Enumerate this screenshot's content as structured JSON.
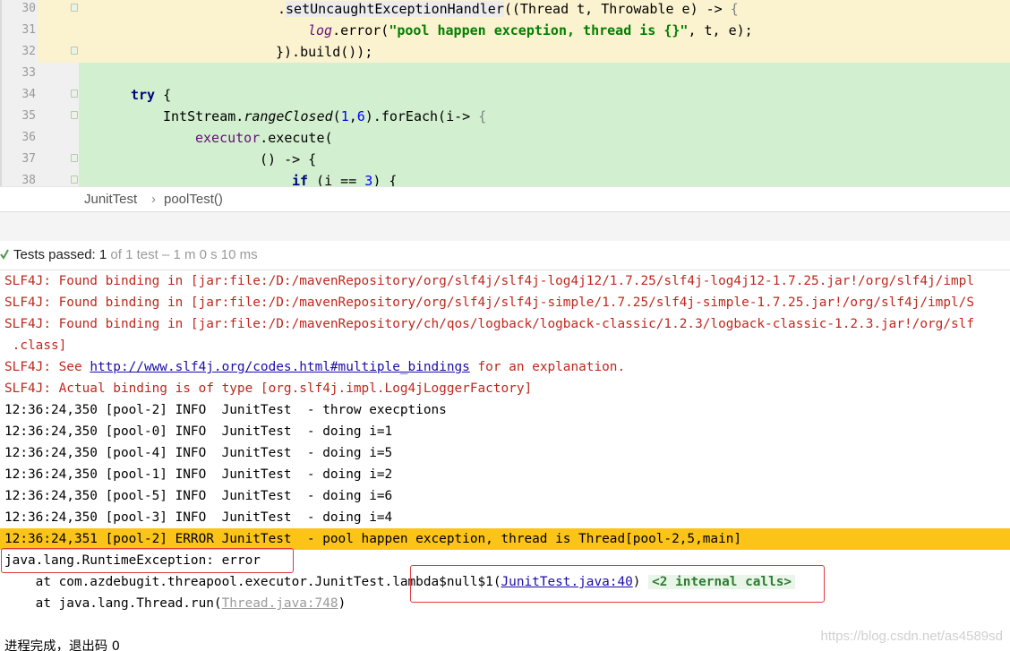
{
  "editor": {
    "lines": [
      {
        "num": "30",
        "code": ".setUncaughtExceptionHandler((Thread t, Throwable e) -> {"
      },
      {
        "num": "31",
        "code": "log.error(\"pool happen exception, thread is {}\", t, e);"
      },
      {
        "num": "32",
        "code": "}).build());"
      },
      {
        "num": "33",
        "code": ""
      },
      {
        "num": "34",
        "code": "try {"
      },
      {
        "num": "35",
        "code": "IntStream.rangeClosed(1,6).forEach(i-> {"
      },
      {
        "num": "36",
        "code": "executor.execute("
      },
      {
        "num": "37",
        "code": "() -> {"
      },
      {
        "num": "38",
        "code": "if (i == 3) {"
      }
    ],
    "tokens": {
      "l30_a": ".",
      "l30_b": "setUncaughtExceptionHandler",
      "l30_c": "((Thread t, Throwable e) -> ",
      "l30_d": "{",
      "l31_a": "log",
      "l31_b": ".error(",
      "l31_c": "\"pool happen exception, thread is {}\"",
      "l31_d": ", t, e);",
      "l32": "}).build());",
      "l34_a": "try",
      "l34_b": " {",
      "l35_a": "IntStream.",
      "l35_b": "rangeClosed",
      "l35_c": "(",
      "l35_d": "1",
      "l35_e": ",",
      "l35_f": "6",
      "l35_g": ").forEach(i-> ",
      "l35_h": "{",
      "l36_a": "executor",
      "l36_b": ".execute(",
      "l37": "() -> {",
      "l38_a": "if",
      "l38_b": " (i == ",
      "l38_c": "3",
      "l38_d": ") {"
    }
  },
  "breadcrumb": {
    "class_name": "JunitTest",
    "separator": "›",
    "method": "poolTest()"
  },
  "test_status": {
    "label": "Tests passed:",
    "count": "1",
    "detail": "of 1 test – 1 m 0 s 10 ms"
  },
  "console": {
    "line1": "SLF4J: Found binding in [jar:file:/D:/mavenRepository/org/slf4j/slf4j-log4j12/1.7.25/slf4j-log4j12-1.7.25.jar!/org/slf4j/impl",
    "line2": "SLF4J: Found binding in [jar:file:/D:/mavenRepository/org/slf4j/slf4j-simple/1.7.25/slf4j-simple-1.7.25.jar!/org/slf4j/impl/S",
    "line3": "SLF4J: Found binding in [jar:file:/D:/mavenRepository/ch/qos/logback/logback-classic/1.2.3/logback-classic-1.2.3.jar!/org/slf",
    "line4": " .class]",
    "line5_a": "SLF4J: See ",
    "line5_link": "http://www.slf4j.org/codes.html#multiple_bindings",
    "line5_b": " for an explanation.",
    "line6": "SLF4J: Actual binding is of type [org.slf4j.impl.Log4jLoggerFactory]",
    "info_lines": [
      "12:36:24,350 [pool-2] INFO  JunitTest  - throw execptions",
      "12:36:24,350 [pool-0] INFO  JunitTest  - doing i=1",
      "12:36:24,350 [pool-4] INFO  JunitTest  - doing i=5",
      "12:36:24,350 [pool-1] INFO  JunitTest  - doing i=2",
      "12:36:24,350 [pool-5] INFO  JunitTest  - doing i=6",
      "12:36:24,350 [pool-3] INFO  JunitTest  - doing i=4"
    ],
    "error_line": "12:36:24,351 [pool-2] ERROR JunitTest  - pool happen exception, thread is Thread[pool-2,5,main]",
    "exception": "java.lang.RuntimeException: error",
    "stack1_a": "    at com.azdebugit.threapool.executor.JunitTest.lambda$null$1(",
    "stack1_link": "JunitTest.java:40",
    "stack1_b": ")",
    "stack1_internal": "<2 internal calls>",
    "stack2_a": "    at java.lang.Thread.run(",
    "stack2_link": "Thread.java:748",
    "stack2_b": ")",
    "exit_message": "进程完成，退出码 0"
  },
  "watermark": "https://blog.csdn.net/as4589sd",
  "colors": {
    "error_highlight": "#fcc419",
    "console_error_text": "#c0271d",
    "code_change_green": "#d2efcf",
    "code_change_yellow": "#fbf2d0"
  }
}
